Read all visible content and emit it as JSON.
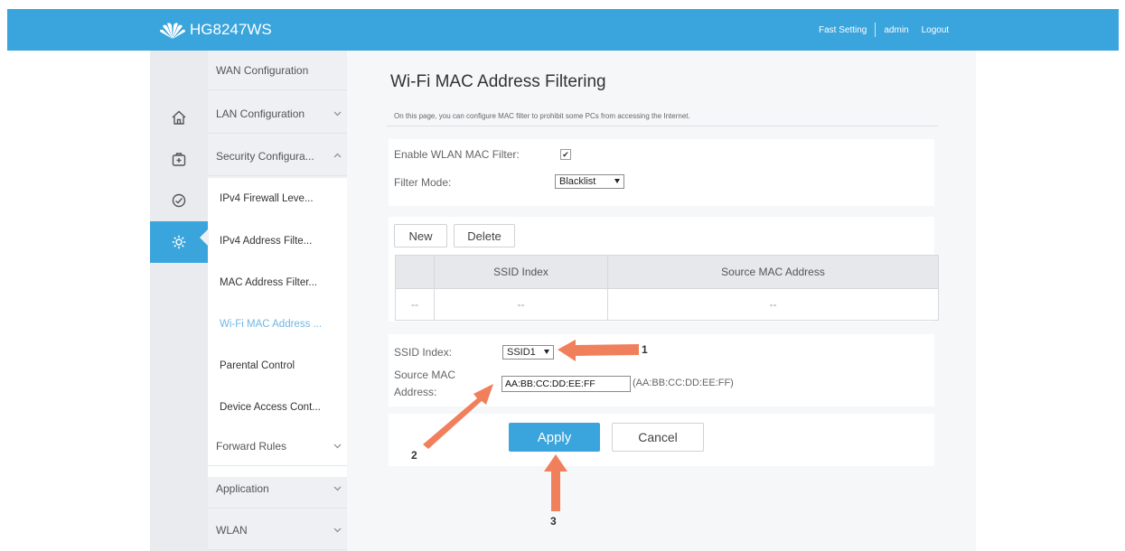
{
  "header": {
    "brand": "HG8247WS",
    "links": {
      "fast_setting": "Fast Setting",
      "user": "admin",
      "logout": "Logout"
    }
  },
  "sidebar": {
    "icons": [
      "home-icon",
      "medkit-icon",
      "gauge-icon",
      "gear-icon"
    ],
    "items": [
      {
        "label": "WAN Configuration"
      },
      {
        "label": "LAN Configuration"
      },
      {
        "label": "Security Configura..."
      },
      {
        "label": "Forward Rules"
      },
      {
        "label": "Application"
      },
      {
        "label": "WLAN"
      }
    ],
    "security_sub": [
      {
        "label": "IPv4 Firewall Leve..."
      },
      {
        "label": "IPv4 Address Filte..."
      },
      {
        "label": "MAC Address Filter..."
      },
      {
        "label": "Wi-Fi MAC Address ..."
      },
      {
        "label": "Parental Control"
      },
      {
        "label": "Device Access Cont..."
      }
    ]
  },
  "main": {
    "title": "Wi-Fi MAC Address Filtering",
    "description": "On this page, you can configure MAC filter to prohibit some PCs from accessing the Internet.",
    "enable_label": "Enable WLAN MAC Filter:",
    "enable_checked": true,
    "filter_mode_label": "Filter Mode:",
    "filter_mode_value": "Blacklist",
    "new_button": "New",
    "delete_button": "Delete",
    "table": {
      "columns": [
        "SSID Index",
        "Source MAC Address"
      ],
      "rows": [
        [
          "--",
          "--",
          "--"
        ]
      ]
    },
    "ssid_label": "SSID Index:",
    "ssid_value": "SSID1",
    "mac_label_1": "Source MAC",
    "mac_label_2": "Address:",
    "mac_value": "AA:BB:CC:DD:EE:FF",
    "mac_hint": "(AA:BB:CC:DD:EE:FF)",
    "apply_button": "Apply",
    "cancel_button": "Cancel"
  },
  "annotations": {
    "step1": "1",
    "step2": "2",
    "step3": "3",
    "arrow_color": "#f07f5c"
  }
}
